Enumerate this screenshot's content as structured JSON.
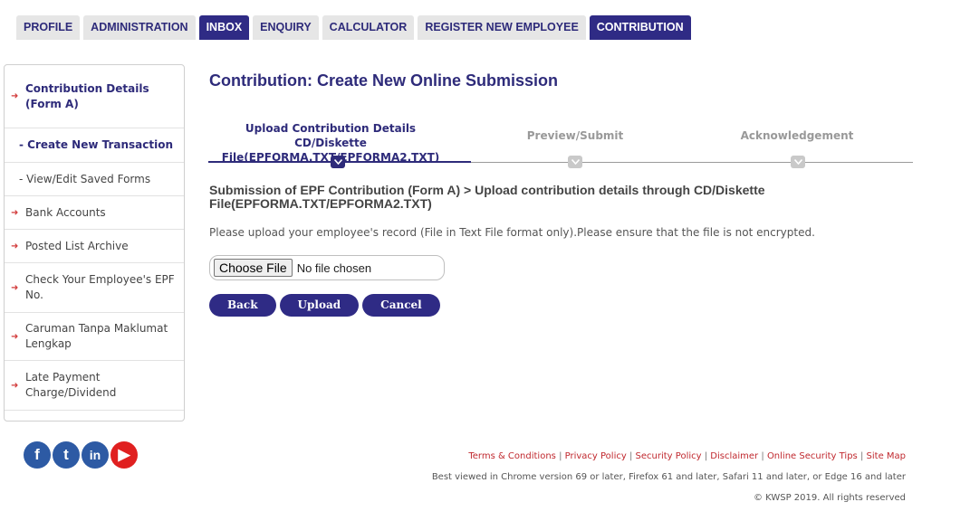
{
  "tabs": [
    "PROFILE",
    "ADMINISTRATION",
    "INBOX",
    "ENQUIRY",
    "CALCULATOR",
    "REGISTER NEW EMPLOYEE",
    "CONTRIBUTION"
  ],
  "sidebar": {
    "items": [
      {
        "label": "Contribution Details (Form A)"
      },
      {
        "label": "- Create New Transaction"
      },
      {
        "label": "- View/Edit Saved Forms"
      },
      {
        "label": "Bank Accounts"
      },
      {
        "label": "Posted List Archive"
      },
      {
        "label": "Check Your Employee's EPF No."
      },
      {
        "label": "Caruman Tanpa Maklumat Lengkap"
      },
      {
        "label": "Late Payment Charge/Dividend"
      }
    ]
  },
  "main": {
    "title": "Contribution: Create New Online Submission",
    "steps": [
      {
        "label": "Upload Contribution Details CD/Diskette File(EPFORMA.TXT/EPFORMA2.TXT)"
      },
      {
        "label": "Preview/Submit"
      },
      {
        "label": "Acknowledgement"
      }
    ],
    "subtitle": "Submission of EPF Contribution (Form A) > Upload contribution details through CD/Diskette File(EPFORMA.TXT/EPFORMA2.TXT)",
    "instruction": "Please upload your employee's record (File in Text File format only).Please ensure that the file is not encrypted.",
    "file_input": {
      "button": "Choose File",
      "status": "No file chosen"
    },
    "buttons": {
      "back": "Back",
      "upload": "Upload",
      "cancel": "Cancel"
    }
  },
  "social": {
    "facebook": "f",
    "twitter": "t",
    "linkedin": "in",
    "youtube": "▶"
  },
  "footer": {
    "links": [
      "Terms & Conditions",
      "Privacy Policy",
      "Security Policy",
      "Disclaimer",
      "Online Security Tips",
      "Site Map"
    ],
    "separator": "|",
    "note": "Best viewed in Chrome version 69 or later, Firefox 61 and later, Safari 11 and later, or Edge 16 and later",
    "copyright": "© KWSP 2019. All rights reserved"
  },
  "colors": {
    "brand": "#2f2b85",
    "link_red": "#c0282e",
    "youtube": "#e02020",
    "social_blue": "#2d5aa4"
  }
}
